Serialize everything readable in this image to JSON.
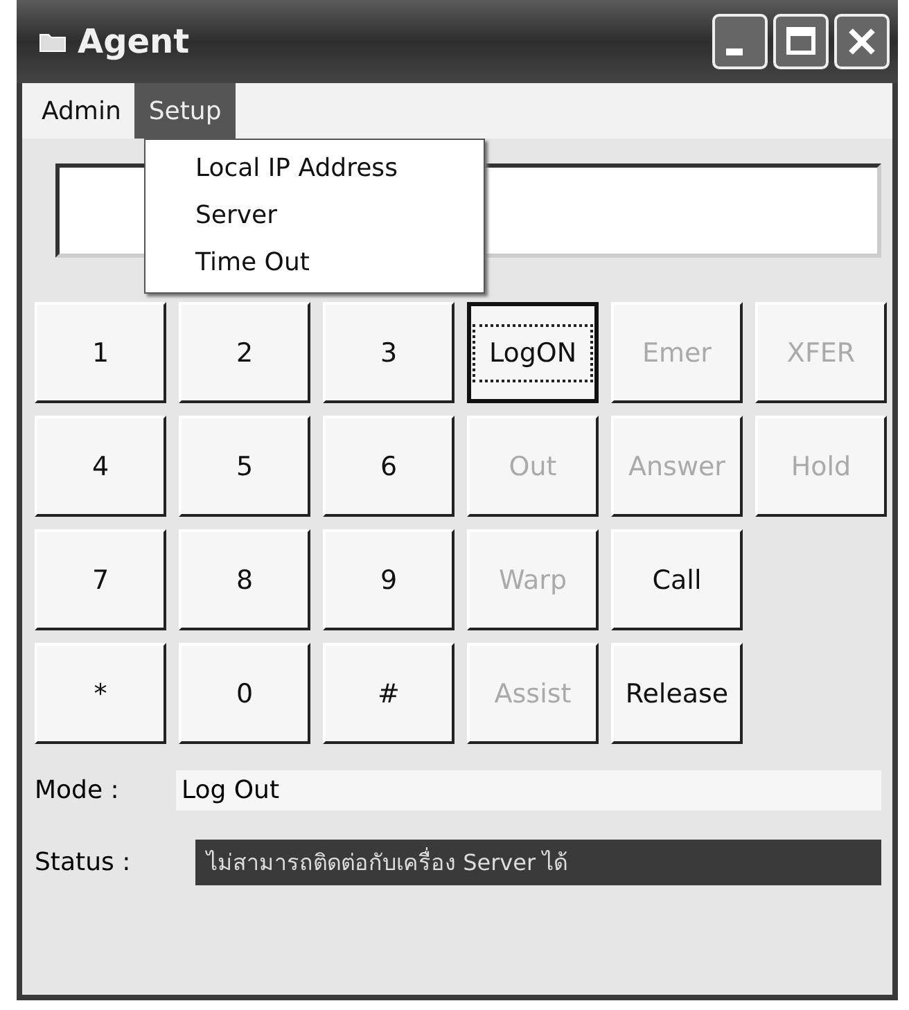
{
  "window": {
    "title": "Agent"
  },
  "menu": [
    {
      "label": "Admin",
      "selected": false
    },
    {
      "label": "Setup",
      "selected": true
    }
  ],
  "dropdown": {
    "items": [
      {
        "label": "Local IP Address"
      },
      {
        "label": "Server"
      },
      {
        "label": "Time Out"
      }
    ]
  },
  "keypad": [
    [
      {
        "label": "1",
        "disabled": false,
        "focused": false
      },
      {
        "label": "2",
        "disabled": false,
        "focused": false
      },
      {
        "label": "3",
        "disabled": false,
        "focused": false
      },
      {
        "label": "LogON",
        "disabled": false,
        "focused": true
      },
      {
        "label": "Emer",
        "disabled": true,
        "focused": false
      },
      {
        "label": "XFER",
        "disabled": true,
        "focused": false
      }
    ],
    [
      {
        "label": "4",
        "disabled": false,
        "focused": false
      },
      {
        "label": "5",
        "disabled": false,
        "focused": false
      },
      {
        "label": "6",
        "disabled": false,
        "focused": false
      },
      {
        "label": "Out",
        "disabled": true,
        "focused": false
      },
      {
        "label": "Answer",
        "disabled": true,
        "focused": false
      },
      {
        "label": "Hold",
        "disabled": true,
        "focused": false
      }
    ],
    [
      {
        "label": "7",
        "disabled": false,
        "focused": false
      },
      {
        "label": "8",
        "disabled": false,
        "focused": false
      },
      {
        "label": "9",
        "disabled": false,
        "focused": false
      },
      {
        "label": "Warp",
        "disabled": true,
        "focused": false
      },
      {
        "label": "Call",
        "disabled": false,
        "focused": false
      }
    ],
    [
      {
        "label": "*",
        "disabled": false,
        "focused": false
      },
      {
        "label": "0",
        "disabled": false,
        "focused": false
      },
      {
        "label": "#",
        "disabled": false,
        "focused": false
      },
      {
        "label": "Assist",
        "disabled": true,
        "focused": false
      },
      {
        "label": "Release",
        "disabled": false,
        "focused": false
      }
    ]
  ],
  "mode": {
    "label": "Mode :",
    "value": "Log Out"
  },
  "status": {
    "label": "Status :",
    "value": "ไม่สามารถติดต่อกับเครื่อง Server ได้"
  }
}
